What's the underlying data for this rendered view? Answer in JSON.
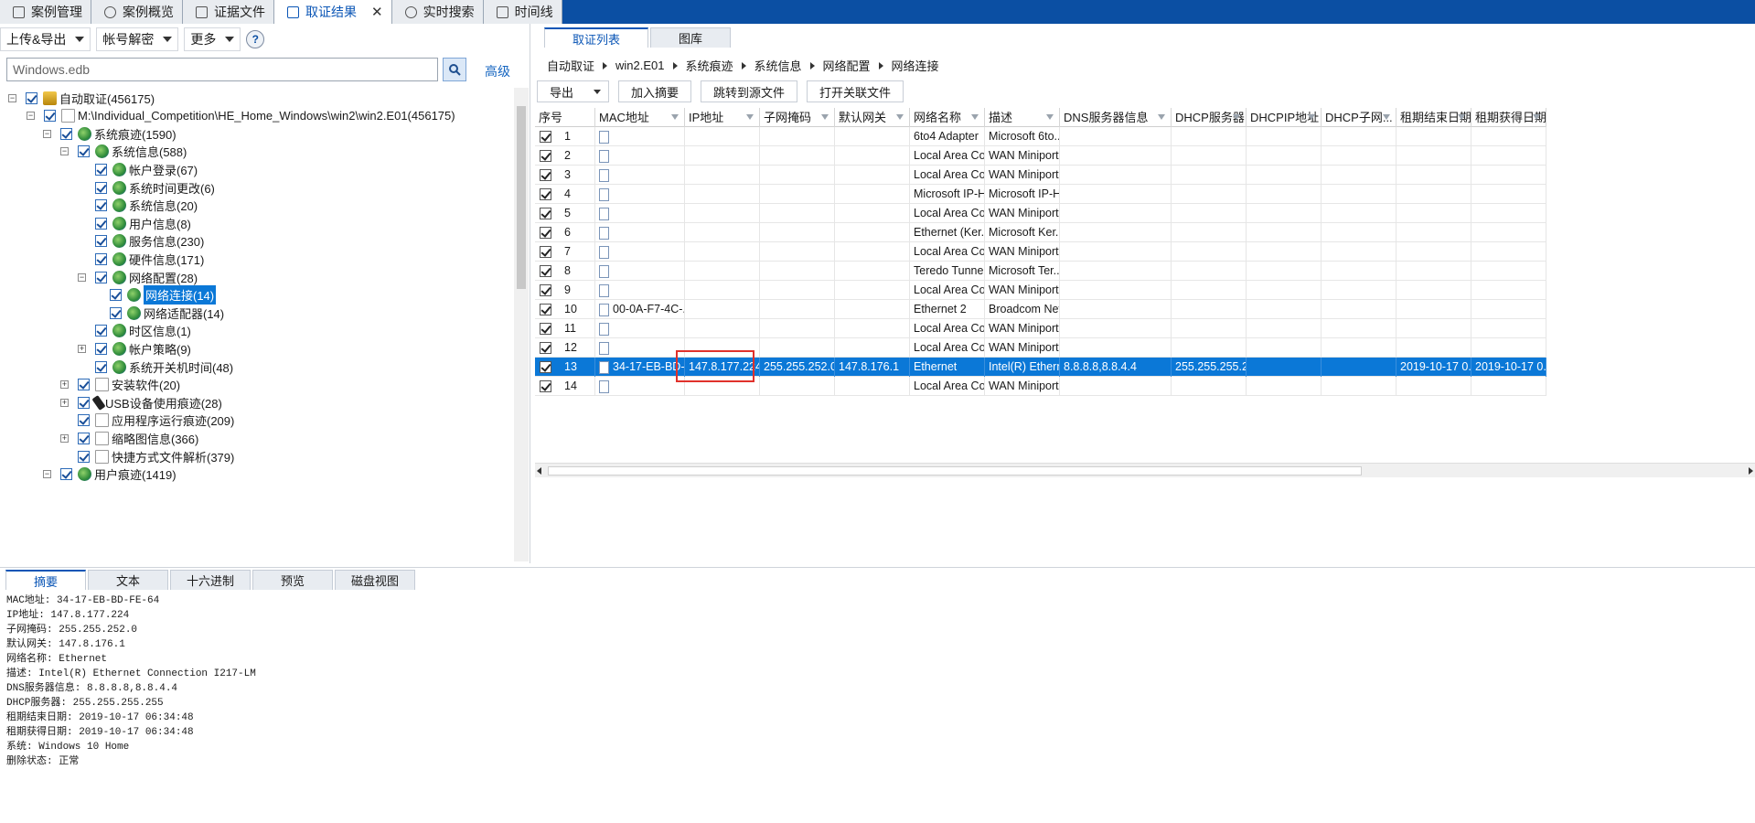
{
  "top_tabs": [
    {
      "label": "案例管理"
    },
    {
      "label": "案例概览"
    },
    {
      "label": "证据文件"
    },
    {
      "label": "取证结果",
      "active": true
    },
    {
      "label": "实时搜索"
    },
    {
      "label": "时间线"
    }
  ],
  "left_toolbar": {
    "upload_export": "上传&导出",
    "account_decrypt": "帐号解密",
    "more": "更多",
    "help": "?"
  },
  "search": {
    "value": "Windows.edb",
    "advanced_label": "高级"
  },
  "tree": [
    {
      "label": "自动取证(456175)",
      "level": 0,
      "expander": "-",
      "icon": "root"
    },
    {
      "label": "M:\\Individual_Competition\\HE_Home_Windows\\win2\\win2.E01(456175)",
      "level": 1,
      "expander": "-",
      "icon": "doc"
    },
    {
      "label": "系统痕迹(1590)",
      "level": 2,
      "expander": "-",
      "icon": "globe"
    },
    {
      "label": "系统信息(588)",
      "level": 3,
      "expander": "-",
      "icon": "globe"
    },
    {
      "label": "帐户登录(67)",
      "level": 4,
      "icon": "globe"
    },
    {
      "label": "系统时间更改(6)",
      "level": 4,
      "icon": "globe"
    },
    {
      "label": "系统信息(20)",
      "level": 4,
      "icon": "globe"
    },
    {
      "label": "用户信息(8)",
      "level": 4,
      "icon": "globe"
    },
    {
      "label": "服务信息(230)",
      "level": 4,
      "icon": "globe"
    },
    {
      "label": "硬件信息(171)",
      "level": 4,
      "icon": "globe"
    },
    {
      "label": "网络配置(28)",
      "level": 4,
      "expander": "-",
      "icon": "globe"
    },
    {
      "label": "网络连接(14)",
      "level": 5,
      "icon": "globe",
      "selected": true
    },
    {
      "label": "网络适配器(14)",
      "level": 5,
      "icon": "globe"
    },
    {
      "label": "时区信息(1)",
      "level": 4,
      "icon": "globe"
    },
    {
      "label": "帐户策略(9)",
      "level": 4,
      "expander": "+",
      "icon": "globe"
    },
    {
      "label": "系统开关机时间(48)",
      "level": 4,
      "icon": "globe"
    },
    {
      "label": "安装软件(20)",
      "level": 3,
      "expander": "+",
      "icon": "doc"
    },
    {
      "label": "USB设备使用痕迹(28)",
      "level": 3,
      "expander": "+",
      "icon": "usb"
    },
    {
      "label": "应用程序运行痕迹(209)",
      "level": 3,
      "icon": "doc"
    },
    {
      "label": "缩略图信息(366)",
      "level": 3,
      "expander": "+",
      "icon": "doc"
    },
    {
      "label": "快捷方式文件解析(379)",
      "level": 3,
      "icon": "doc"
    },
    {
      "label": "用户痕迹(1419)",
      "level": 2,
      "expander": "-",
      "icon": "globe"
    }
  ],
  "right_tabs": [
    {
      "label": "取证列表",
      "active": true
    },
    {
      "label": "图库"
    }
  ],
  "breadcrumb": [
    "自动取证",
    "win2.E01",
    "系统痕迹",
    "系统信息",
    "网络配置",
    "网络连接"
  ],
  "right_toolbar": {
    "export": "导出",
    "add_summary": "加入摘要",
    "jump_source": "跳转到源文件",
    "open_related": "打开关联文件"
  },
  "grid": {
    "columns": [
      "序号",
      "MAC地址",
      "IP地址",
      "子网掩码",
      "默认网关",
      "网络名称",
      "描述",
      "DNS服务器信息",
      "DHCP服务器",
      "DHCPIP地址",
      "DHCP子网...",
      "租期结束日期",
      "租期获得日期"
    ],
    "rows": [
      [
        "1",
        "",
        "",
        "",
        "",
        "6to4 Adapter",
        "Microsoft 6to...",
        "",
        "",
        "",
        "",
        "",
        ""
      ],
      [
        "2",
        "",
        "",
        "",
        "",
        "Local Area Co...",
        "WAN Miniport...",
        "",
        "",
        "",
        "",
        "",
        ""
      ],
      [
        "3",
        "",
        "",
        "",
        "",
        "Local Area Co...",
        "WAN Miniport...",
        "",
        "",
        "",
        "",
        "",
        ""
      ],
      [
        "4",
        "",
        "",
        "",
        "",
        "Microsoft IP-H...",
        "Microsoft IP-H...",
        "",
        "",
        "",
        "",
        "",
        ""
      ],
      [
        "5",
        "",
        "",
        "",
        "",
        "Local Area Co...",
        "WAN Miniport...",
        "",
        "",
        "",
        "",
        "",
        ""
      ],
      [
        "6",
        "",
        "",
        "",
        "",
        "Ethernet (Ker...",
        "Microsoft Ker...",
        "",
        "",
        "",
        "",
        "",
        ""
      ],
      [
        "7",
        "",
        "",
        "",
        "",
        "Local Area Co...",
        "WAN Miniport...",
        "",
        "",
        "",
        "",
        "",
        ""
      ],
      [
        "8",
        "",
        "",
        "",
        "",
        "Teredo Tunne...",
        "Microsoft Ter...",
        "",
        "",
        "",
        "",
        "",
        ""
      ],
      [
        "9",
        "",
        "",
        "",
        "",
        "Local Area Co...",
        "WAN Miniport...",
        "",
        "",
        "",
        "",
        "",
        ""
      ],
      [
        "10",
        "00-0A-F7-4C-...",
        "",
        "",
        "",
        "Ethernet 2",
        "Broadcom Net...",
        "",
        "",
        "",
        "",
        "",
        ""
      ],
      [
        "11",
        "",
        "",
        "",
        "",
        "Local Area Co...",
        "WAN Miniport...",
        "",
        "",
        "",
        "",
        "",
        ""
      ],
      [
        "12",
        "",
        "",
        "",
        "",
        "Local Area Co...",
        "WAN Miniport...",
        "",
        "",
        "",
        "",
        "",
        ""
      ],
      [
        "13",
        "34-17-EB-BD-...",
        "147.8.177.224",
        "255.255.252.0",
        "147.8.176.1",
        "Ethernet",
        "Intel(R) Ethern...",
        "8.8.8.8,8.8.4.4",
        "255.255.255.255",
        "",
        "",
        "2019-10-17 0...",
        "2019-10-17 0..."
      ],
      [
        "14",
        "",
        "",
        "",
        "",
        "Local Area Co...",
        "WAN Miniport...",
        "",
        "",
        "",
        "",
        "",
        ""
      ]
    ],
    "selected_row": "13",
    "highlight_color": "#e0312b"
  },
  "bottom_tabs": [
    {
      "label": "摘要",
      "active": true
    },
    {
      "label": "文本"
    },
    {
      "label": "十六进制"
    },
    {
      "label": "预览"
    },
    {
      "label": "磁盘视图"
    }
  ],
  "summary_lines": [
    "MAC地址: 34-17-EB-BD-FE-64",
    "IP地址: 147.8.177.224",
    "子网掩码: 255.255.252.0",
    "默认网关: 147.8.176.1",
    "网络名称: Ethernet",
    "描述: Intel(R) Ethernet Connection I217-LM",
    "DNS服务器信息: 8.8.8.8,8.8.4.4",
    "DHCP服务器: 255.255.255.255",
    "租期结束日期: 2019-10-17 06:34:48",
    "租期获得日期: 2019-10-17 06:34:48",
    "系统: Windows 10 Home",
    "删除状态: 正常"
  ],
  "colors": {
    "title_bar": "#0b4fa3",
    "selection": "#0b78d7",
    "accent": "#0b56b6"
  }
}
